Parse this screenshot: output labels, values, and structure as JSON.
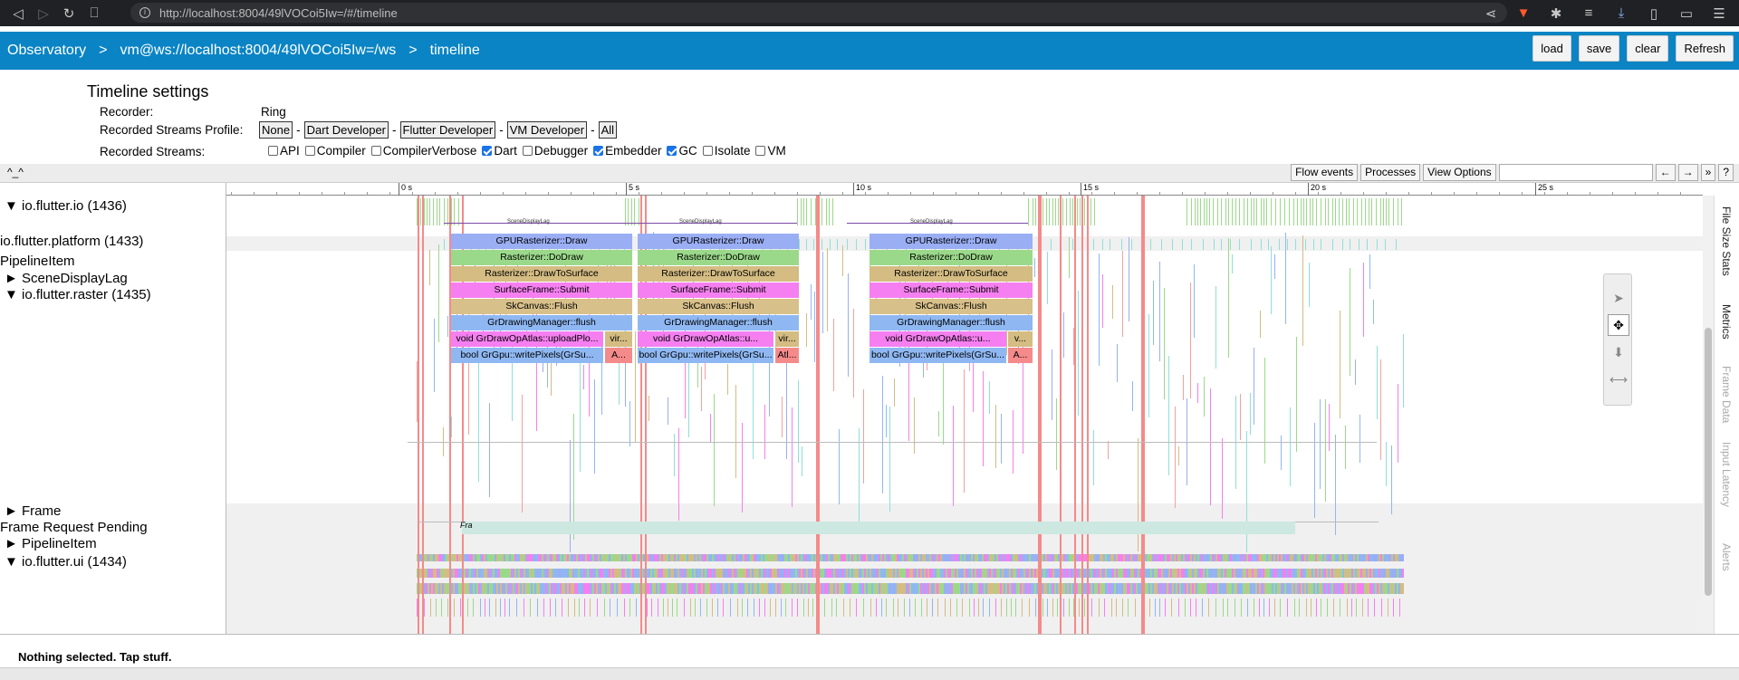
{
  "browser": {
    "url": "http://localhost:8004/49lVOCoi5Iw=/#/timeline",
    "icons": [
      "back-icon",
      "forward-icon",
      "reload-icon",
      "bookmark-icon",
      "share-icon",
      "brave-icon",
      "extensions-icon",
      "playlist-icon",
      "download-icon",
      "sidebar-icon",
      "wallet-icon",
      "menu-icon"
    ]
  },
  "header": {
    "crumbs": [
      "Observatory",
      "vm@ws://localhost:8004/49lVOCoi5Iw=/ws",
      "timeline"
    ],
    "separator": ">",
    "buttons": {
      "load": "load",
      "save": "save",
      "clear": "clear",
      "refresh": "Refresh"
    },
    "color": "#0a84c4"
  },
  "settings": {
    "title": "Timeline settings",
    "recorder_label": "Recorder:",
    "recorder_value": "Ring",
    "profile_label": "Recorded Streams Profile:",
    "profiles": [
      "None",
      "Dart Developer",
      "Flutter Developer",
      "VM Developer",
      "All"
    ],
    "profile_sep": "-",
    "streams_label": "Recorded Streams:",
    "streams": [
      {
        "name": "API",
        "checked": false
      },
      {
        "name": "Compiler",
        "checked": false
      },
      {
        "name": "CompilerVerbose",
        "checked": false
      },
      {
        "name": "Dart",
        "checked": true
      },
      {
        "name": "Debugger",
        "checked": false
      },
      {
        "name": "Embedder",
        "checked": true
      },
      {
        "name": "GC",
        "checked": true
      },
      {
        "name": "Isolate",
        "checked": false
      },
      {
        "name": "VM",
        "checked": false
      }
    ]
  },
  "toolbar": {
    "collapse": "^_^",
    "flow_events": "Flow events",
    "processes": "Processes",
    "view_options": "View Options",
    "prev": "←",
    "next": "→",
    "more": "»",
    "help": "?"
  },
  "tracks": {
    "labels": {
      "flutter_io": "▼ io.flutter.io (1436)",
      "platform": "io.flutter.platform (1433)",
      "pipeline_item": "PipelineItem",
      "scene_display_lag": "► SceneDisplayLag",
      "raster": "▼ io.flutter.raster (1435)",
      "frame": "► Frame",
      "frame_request_pending": "Frame Request Pending",
      "pipeline_item2": "► PipelineItem",
      "ui": "▼ io.flutter.ui (1434)"
    },
    "ruler_ticks": [
      "0 s",
      "5 s",
      "10 s",
      "15 s",
      "20 s",
      "25 s"
    ],
    "slice_names": [
      "GPURasterizer::Draw",
      "Rasterizer::DoDraw",
      "Rasterizer::DrawToSurface",
      "SurfaceFrame::Submit",
      "SkCanvas::Flush",
      "GrDrawingManager::flush"
    ],
    "slice_colors": [
      "#9aaef4",
      "#9bd98a",
      "#d4bc82",
      "#f57ff0",
      "#d8c08a",
      "#8fb8f3"
    ],
    "groups": [
      {
        "op": "void GrDrawOpAtlas::uploadPlo...",
        "op2": "vir...",
        "wp": "bool GrGpu::writePixels(GrSu...",
        "wp2": "A..."
      },
      {
        "op": "void GrDrawOpAtlas::u...",
        "op2": "vir...",
        "wp": "bool GrGpu::writePixels(GrSu...",
        "wp2": "Atl..."
      },
      {
        "op": "void GrDrawOpAtlas::u...",
        "op2": "v...",
        "wp": "bool GrGpu::writePixels(GrSu...",
        "wp2": "A..."
      }
    ],
    "scene_lag_label": "SceneDisplayLag",
    "frame_label": "Fra"
  },
  "side_tabs": [
    "File Size Stats",
    "Metrics",
    "Frame Data",
    "Input Latency",
    "Alerts"
  ],
  "status": {
    "text": "Nothing selected. Tap stuff."
  }
}
